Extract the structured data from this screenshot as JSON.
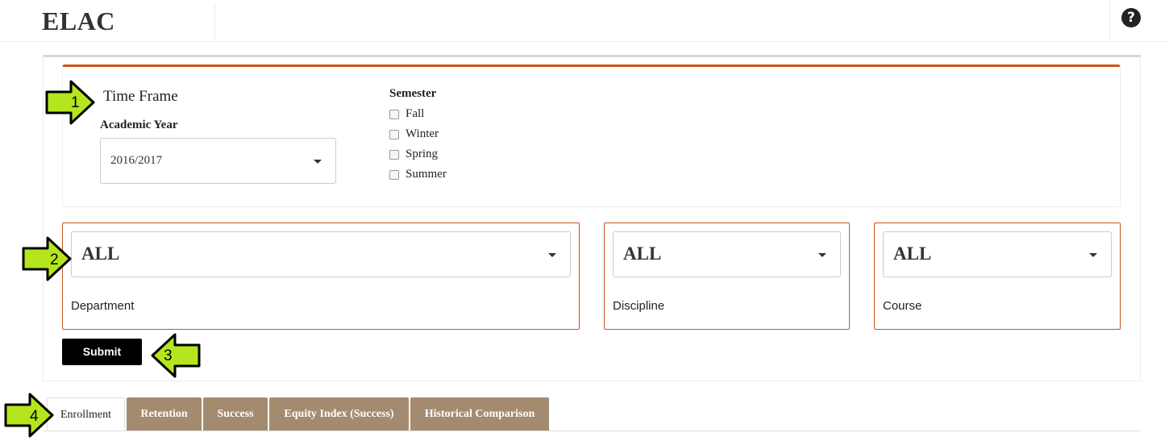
{
  "app": {
    "title": "ELAC",
    "help_icon": "question-circle-icon"
  },
  "time_frame": {
    "title": "Time Frame",
    "academic_year": {
      "label": "Academic Year",
      "value": "2016/2017"
    },
    "semester": {
      "label": "Semester",
      "options": [
        {
          "label": "Fall",
          "checked": false
        },
        {
          "label": "Winter",
          "checked": false
        },
        {
          "label": "Spring",
          "checked": false
        },
        {
          "label": "Summer",
          "checked": false
        }
      ]
    }
  },
  "filters": {
    "department": {
      "value": "ALL",
      "label": "Department"
    },
    "discipline": {
      "value": "ALL",
      "label": "Discipline"
    },
    "course": {
      "value": "ALL",
      "label": "Course"
    }
  },
  "submit_label": "Submit",
  "tabs": [
    {
      "label": "Enrollment",
      "active": true
    },
    {
      "label": "Retention",
      "active": false
    },
    {
      "label": "Success",
      "active": false
    },
    {
      "label": "Equity Index (Success)",
      "active": false
    },
    {
      "label": "Historical Comparison",
      "active": false
    }
  ],
  "callouts": [
    "1",
    "2",
    "3",
    "4"
  ],
  "colors": {
    "accent": "#c8581c",
    "tab": "#a48b6f",
    "callout": "#b5e61d"
  }
}
